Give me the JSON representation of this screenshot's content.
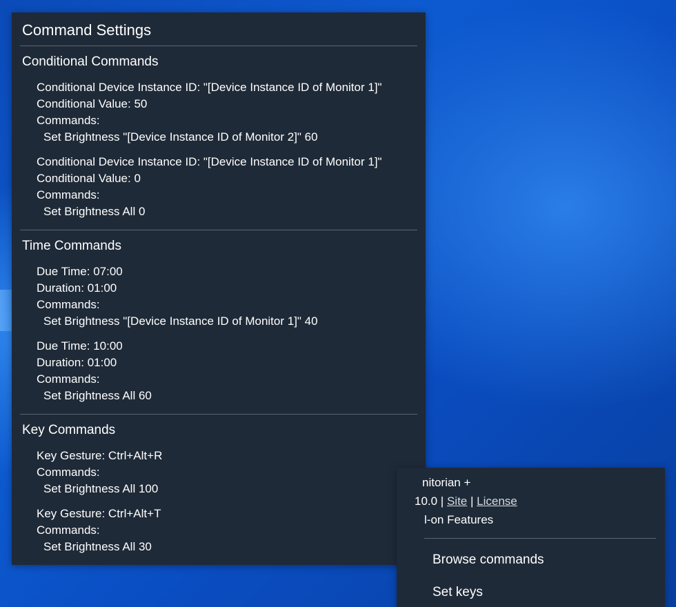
{
  "settings": {
    "title": "Command Settings",
    "conditional": {
      "heading": "Conditional Commands",
      "entries": [
        {
          "device": "Conditional Device Instance ID: \"[Device Instance ID of Monitor 1]\"",
          "value": "Conditional Value: 50",
          "commands_label": "Commands:",
          "command": "Set Brightness \"[Device Instance ID of Monitor 2]\" 60"
        },
        {
          "device": "Conditional Device Instance ID: \"[Device Instance ID of Monitor 1]\"",
          "value": "Conditional Value: 0",
          "commands_label": "Commands:",
          "command": "Set Brightness All 0"
        }
      ]
    },
    "time": {
      "heading": "Time Commands",
      "entries": [
        {
          "due": "Due Time: 07:00",
          "duration": "Duration: 01:00",
          "commands_label": "Commands:",
          "command": "Set Brightness \"[Device Instance ID of Monitor 1]\" 40"
        },
        {
          "due": "Due Time: 10:00",
          "duration": "Duration: 01:00",
          "commands_label": "Commands:",
          "command": "Set Brightness All 60"
        }
      ]
    },
    "key": {
      "heading": "Key Commands",
      "entries": [
        {
          "gesture": "Key Gesture: Ctrl+Alt+R",
          "commands_label": "Commands:",
          "command": "Set Brightness All 100"
        },
        {
          "gesture": "Key Gesture: Ctrl+Alt+T",
          "commands_label": "Commands:",
          "command": "Set Brightness All 30"
        }
      ]
    }
  },
  "menu": {
    "app_name": "nitorian +",
    "version": "10.0 |",
    "site": "Site",
    "separator": "|",
    "license": "License",
    "addon": "l-on Features",
    "browse": "Browse commands",
    "set_keys": "Set keys"
  },
  "colors": {
    "window_bg": "#1f2a38",
    "divider": "#5b6573",
    "desktop_blue": "#0d5ad0"
  }
}
